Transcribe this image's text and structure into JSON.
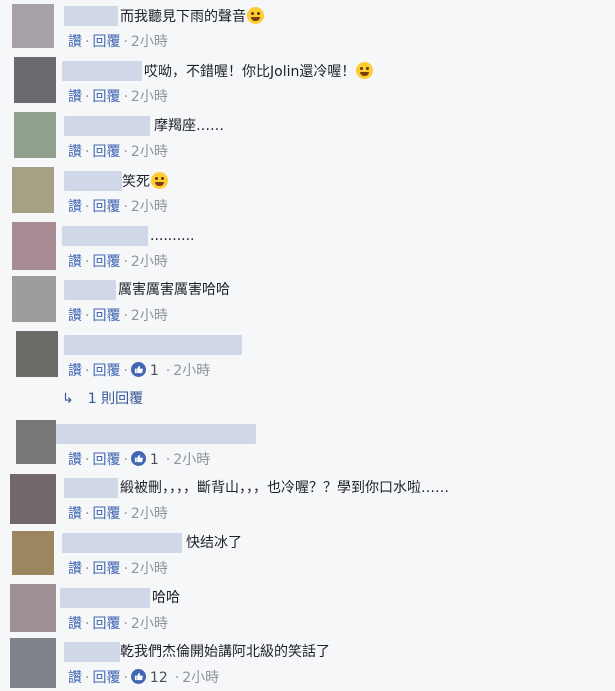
{
  "actions": {
    "like": "讚",
    "reply": "回覆",
    "dot": "·"
  },
  "view_replies": "1 則回覆",
  "comments": [
    {
      "text": "而我聽見下雨的聲音",
      "emoji": "grinning-sweat",
      "time": "2小時",
      "likes": ""
    },
    {
      "text": "哎呦，不錯喔！你比Jolin還冷喔！",
      "emoji": "winking-tongue",
      "time": "2小時",
      "likes": ""
    },
    {
      "text": "摩羯座……",
      "emoji": "",
      "time": "2小時",
      "likes": ""
    },
    {
      "text": "笑死",
      "emoji": "tears-of-joy",
      "time": "2小時",
      "likes": ""
    },
    {
      "text": "..........",
      "emoji": "",
      "time": "2小時",
      "likes": ""
    },
    {
      "text": "厲害厲害厲害哈哈",
      "emoji": "",
      "time": "2小時",
      "likes": ""
    },
    {
      "text": "",
      "emoji": "",
      "time": "2小時",
      "likes": "1"
    },
    {
      "text": "",
      "emoji": "",
      "time": "2小時",
      "likes": "1"
    },
    {
      "text": "緞被刪，，，，斷背山，，，也冷喔？？學到你口水啦……",
      "emoji": "",
      "time": "2小時",
      "likes": ""
    },
    {
      "text": "快结冰了",
      "emoji": "",
      "time": "2小時",
      "likes": ""
    },
    {
      "text": "哈哈",
      "emoji": "",
      "time": "2小時",
      "likes": ""
    },
    {
      "text": "乾我們杰倫開始講阿北級的笑話了",
      "emoji": "",
      "time": "2小時",
      "likes": "12"
    }
  ],
  "colors": {
    "background": "#f6f7f9",
    "link": "#385898",
    "like_badge": "#4267b2",
    "meta": "#90949c"
  }
}
